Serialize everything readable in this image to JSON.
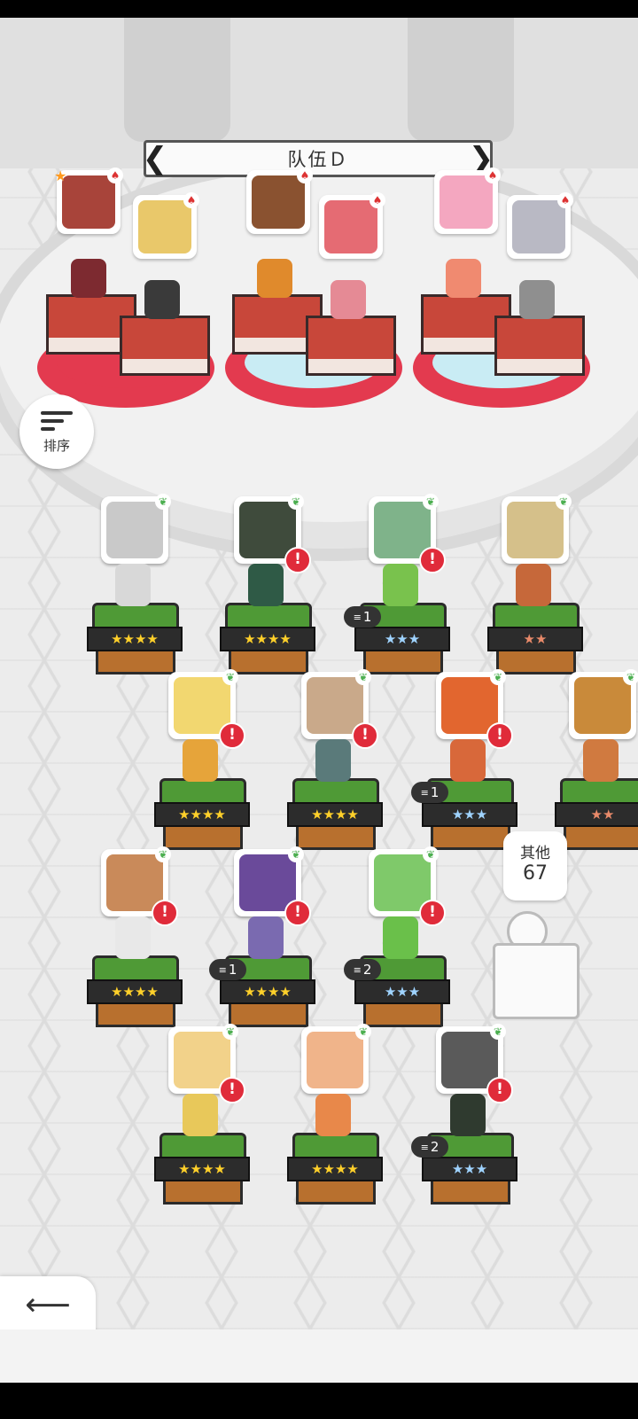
{
  "team": {
    "title": "队伍Ｄ"
  },
  "sort_button": {
    "label": "排序"
  },
  "back_button": {
    "label": "返回"
  },
  "others": {
    "label": "其他",
    "count": "67"
  },
  "team_slots": [
    {
      "name": "slot-1-leader",
      "face": "#a8443a",
      "sprite": "#7d2a30",
      "leader": true
    },
    {
      "name": "slot-2",
      "face": "#e9c86a",
      "sprite": "#3a3a3a",
      "leader": false
    },
    {
      "name": "slot-3",
      "face": "#8a5230",
      "sprite": "#e08a2c",
      "leader": false
    },
    {
      "name": "slot-4",
      "face": "#e56b73",
      "sprite": "#e58a95",
      "leader": false
    },
    {
      "name": "slot-5",
      "face": "#f4a7c0",
      "sprite": "#f08a70",
      "leader": false
    },
    {
      "name": "slot-6",
      "face": "#b9b9c4",
      "sprite": "#8f8f8f",
      "leader": false
    }
  ],
  "heroes": [
    {
      "stars": "★★★★",
      "star_color": "#ffd02a",
      "level": "",
      "alert": false,
      "face": "#c9c9c9",
      "sprite": "#d8d8d8"
    },
    {
      "stars": "★★★★",
      "star_color": "#ffd02a",
      "level": "",
      "alert": true,
      "face": "#3f4b3c",
      "sprite": "#2f5a46"
    },
    {
      "stars": "★★★",
      "star_color": "#9fd3ff",
      "level": "1",
      "alert": true,
      "face": "#7fb38a",
      "sprite": "#79c24d"
    },
    {
      "stars": "★★",
      "star_color": "#e98a6a",
      "level": "",
      "alert": false,
      "face": "#d5c08a",
      "sprite": "#c6683a"
    },
    {
      "stars": "★★★★",
      "star_color": "#ffd02a",
      "level": "",
      "alert": true,
      "face": "#f2d770",
      "sprite": "#e6a43a"
    },
    {
      "stars": "★★★★",
      "star_color": "#ffd02a",
      "level": "",
      "alert": true,
      "face": "#c9a98a",
      "sprite": "#5a7a7a"
    },
    {
      "stars": "★★★",
      "star_color": "#9fd3ff",
      "level": "1",
      "alert": true,
      "face": "#e2662f",
      "sprite": "#d8683a"
    },
    {
      "stars": "★★",
      "star_color": "#e98a6a",
      "level": "",
      "alert": false,
      "face": "#c98a3a",
      "sprite": "#d07a40"
    },
    {
      "stars": "★★★★",
      "star_color": "#ffd02a",
      "level": "",
      "alert": true,
      "face": "#c98a5a",
      "sprite": "#e8e8e8"
    },
    {
      "stars": "★★★★",
      "star_color": "#ffd02a",
      "level": "1",
      "alert": true,
      "face": "#6a4a9a",
      "sprite": "#7a6ab0"
    },
    {
      "stars": "★★★",
      "star_color": "#9fd3ff",
      "level": "2",
      "alert": true,
      "face": "#7fc96a",
      "sprite": "#6ac04a"
    },
    {
      "stars": "★★★★",
      "star_color": "#ffd02a",
      "level": "",
      "alert": true,
      "face": "#f2d28a",
      "sprite": "#e8c85a"
    },
    {
      "stars": "★★★★",
      "star_color": "#ffd02a",
      "level": "",
      "alert": false,
      "face": "#f0b48a",
      "sprite": "#e8884a"
    },
    {
      "stars": "★★★",
      "star_color": "#9fd3ff",
      "level": "2",
      "alert": true,
      "face": "#5a5a5a",
      "sprite": "#2f3a2f"
    }
  ],
  "icons": {
    "leaf": "leaf-icon",
    "alert": "exclamation-icon",
    "class": "spade-icon",
    "leader": "star-icon",
    "sort": "sort-icon",
    "back": "arrow-left-icon"
  }
}
